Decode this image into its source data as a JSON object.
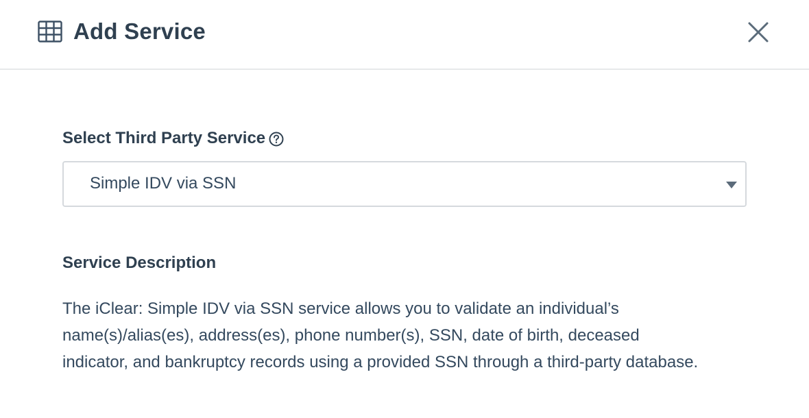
{
  "header": {
    "title": "Add Service",
    "icon": "table-grid-icon",
    "close_icon": "close-icon"
  },
  "form": {
    "service_label": "Select Third Party Service",
    "help_icon": "question-circle-icon",
    "selected_service": "Simple IDV via SSN"
  },
  "description": {
    "heading": "Service Description",
    "text": "The iClear: Simple IDV via SSN service allows you to validate an individual’s name(s)/alias(es), address(es), phone number(s), SSN, date of birth, deceased indicator, and bankruptcy records using a provided SSN through a third-party database."
  },
  "colors": {
    "text_dark": "#2f4050",
    "text_body": "#34495e",
    "border": "#d5d9dd",
    "divider": "#e6e8ea",
    "icon": "#5b6b7a"
  }
}
